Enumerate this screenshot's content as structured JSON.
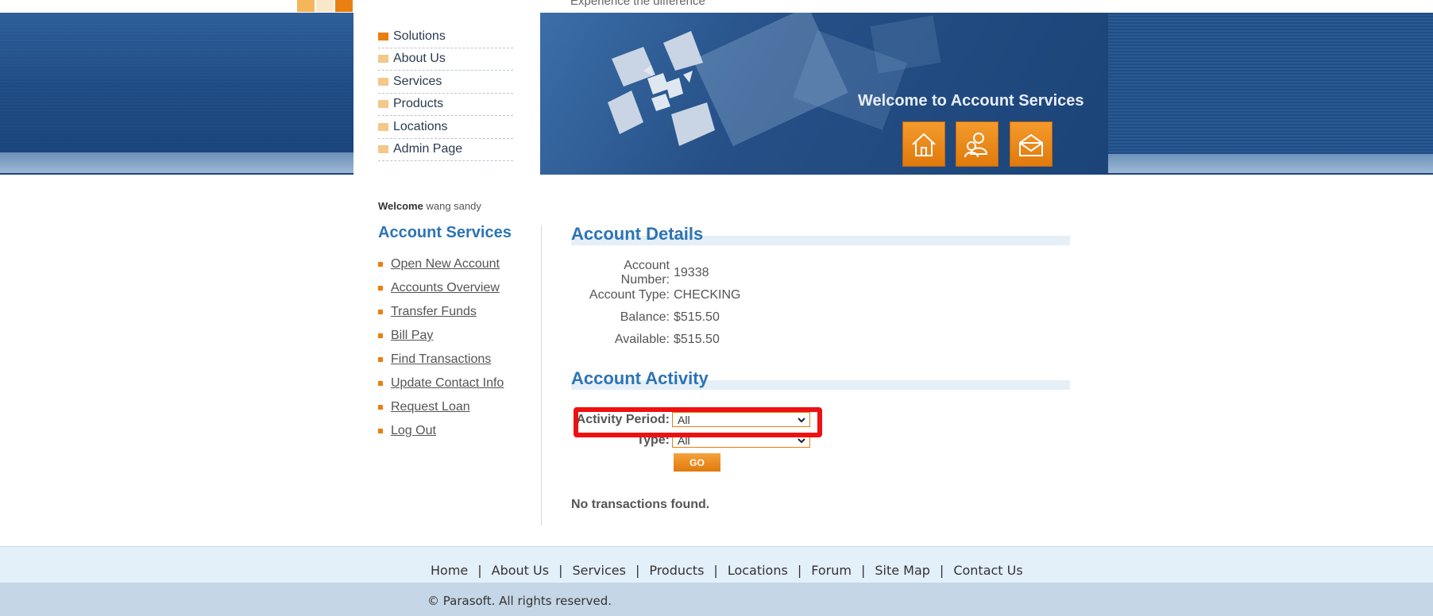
{
  "header": {
    "tagline": "Experience the difference",
    "welcome_title": "Welcome to Account Services",
    "top_square_colors": [
      "#f5b65b",
      "#f8e8c8",
      "#ea7f11"
    ],
    "icons": [
      "home-icon",
      "contact-icon",
      "mail-icon"
    ]
  },
  "nav": {
    "items": [
      {
        "label": "Solutions"
      },
      {
        "label": "About Us"
      },
      {
        "label": "Services"
      },
      {
        "label": "Products"
      },
      {
        "label": "Locations"
      },
      {
        "label": "Admin Page"
      }
    ]
  },
  "sidebar": {
    "welcome_prefix": "Welcome",
    "user_name": "wang sandy",
    "title": "Account Services",
    "items": [
      {
        "label": "Open New Account"
      },
      {
        "label": "Accounts Overview"
      },
      {
        "label": "Transfer Funds"
      },
      {
        "label": "Bill Pay"
      },
      {
        "label": "Find Transactions"
      },
      {
        "label": "Update Contact Info"
      },
      {
        "label": "Request Loan"
      },
      {
        "label": "Log Out"
      }
    ]
  },
  "details": {
    "title": "Account Details",
    "account_number_label": "Account Number:",
    "account_number": "19338",
    "account_type_label": "Account Type:",
    "account_type": "CHECKING",
    "balance_label": "Balance:",
    "balance": "$515.50",
    "available_label": "Available:",
    "available": "$515.50"
  },
  "activity": {
    "title": "Account Activity",
    "period_label": "Activity Period:",
    "period_value": "All",
    "type_label": "Type:",
    "type_value": "All",
    "go_label": "GO",
    "empty_message": "No transactions found."
  },
  "footer": {
    "links": [
      {
        "label": "Home"
      },
      {
        "label": "About Us"
      },
      {
        "label": "Services"
      },
      {
        "label": "Products"
      },
      {
        "label": "Locations"
      },
      {
        "label": "Forum"
      },
      {
        "label": "Site Map"
      },
      {
        "label": "Contact Us"
      }
    ],
    "separator": "|",
    "copyright": "© Parasoft. All rights reserved."
  },
  "colors": {
    "accent_orange": "#ea7f11",
    "title_blue": "#2d74b4",
    "header_navy": "#1c4b82",
    "highlight_red": "#ee1111"
  }
}
